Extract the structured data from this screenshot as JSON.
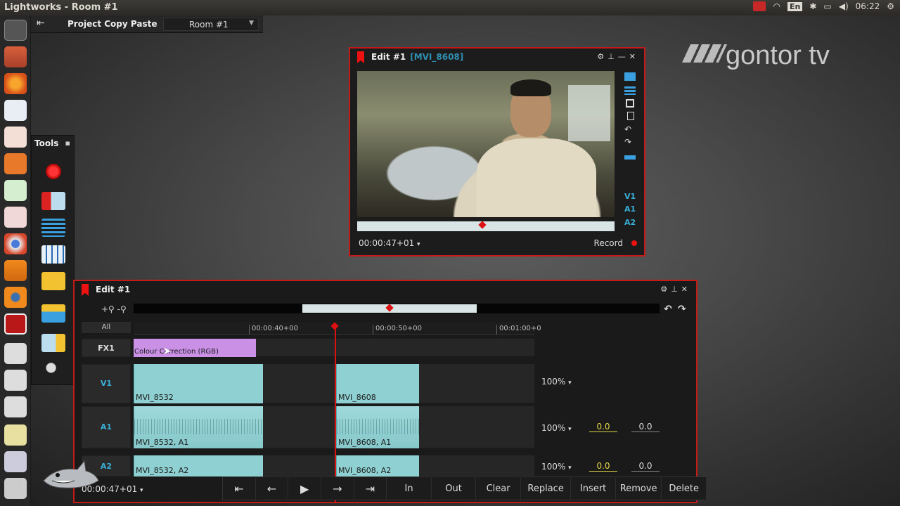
{
  "window": {
    "title": "Lightworks - Room #1"
  },
  "system_tray": {
    "language": "En",
    "clock": "06:22"
  },
  "project": {
    "name": "Project Copy Paste",
    "room": "Room #1"
  },
  "watermark": {
    "text": "gontor tv"
  },
  "tools_panel": {
    "title": "Tools"
  },
  "viewer": {
    "title": "Edit #1",
    "clip_id": "[MVI_8608]",
    "timecode": "00:00:47+01",
    "record_label": "Record",
    "tracks": [
      "V1",
      "A1",
      "A2"
    ]
  },
  "edit": {
    "title": "Edit #1",
    "all_label": "All",
    "timecode": "00:00:47+01",
    "ruler": [
      "00:00:40+00",
      "00:00:50+00",
      "00:01:00+0"
    ],
    "tracks": {
      "fx1": {
        "label": "FX1",
        "clip": "Colour Correction (RGB)"
      },
      "v1": {
        "label": "V1",
        "clips": [
          "MVI_8532",
          "MVI_8608"
        ],
        "level": "100%"
      },
      "a1": {
        "label": "A1",
        "clips": [
          "MVI_8532, A1",
          "MVI_8608, A1"
        ],
        "level": "100%",
        "pan1": "0.0",
        "pan2": "0.0"
      },
      "a2": {
        "label": "A2",
        "clips": [
          "MVI_8532, A2",
          "MVI_8608, A2"
        ],
        "level": "100%",
        "pan1": "0.0",
        "pan2": "0.0"
      }
    }
  },
  "transport": {
    "buttons": [
      "In",
      "Out",
      "Clear",
      "Replace",
      "Insert",
      "Remove",
      "Delete"
    ]
  }
}
